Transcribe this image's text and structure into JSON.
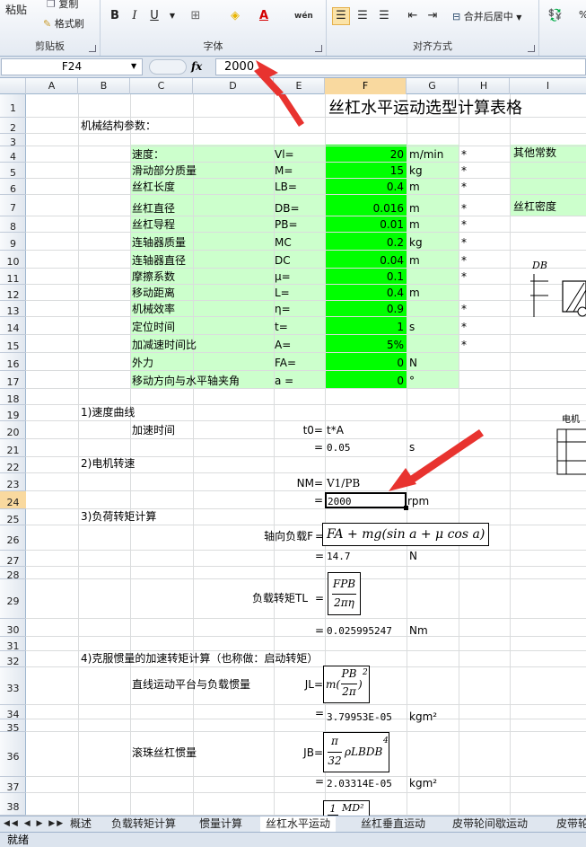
{
  "ribbon": {
    "clipboard": {
      "paste": "粘贴",
      "copy": "复制",
      "format_painter": "格式刷",
      "label": "剪贴板"
    },
    "font": {
      "label": "字体",
      "bold": "B",
      "italic": "I",
      "underline": "U",
      "wen": "wén"
    },
    "alignment": {
      "label": "对齐方式",
      "merge_center": "合并后居中"
    },
    "number": {
      "percent": "%"
    }
  },
  "formula_bar": {
    "name_box": "F24",
    "fx": "fx",
    "value": "2000"
  },
  "columns": [
    "A",
    "B",
    "C",
    "D",
    "E",
    "F",
    "G",
    "H",
    "I"
  ],
  "selected_column": "F",
  "rows": [
    "1",
    "2",
    "3",
    "4",
    "5",
    "6",
    "7",
    "8",
    "9",
    "10",
    "11",
    "12",
    "13",
    "14",
    "15",
    "16",
    "17",
    "18",
    "19",
    "20",
    "21",
    "22",
    "23",
    "24",
    "25",
    "26",
    "27",
    "28",
    "29",
    "30",
    "31",
    "32",
    "33",
    "34",
    "35",
    "36",
    "37",
    "38"
  ],
  "selected_row": "24",
  "sheet": {
    "title": "丝杠水平运动选型计算表格",
    "section_params": "机械结构参数：",
    "params": [
      {
        "name": "速度：",
        "sym": "Vl=",
        "val": "20",
        "unit": "m/min",
        "star": "*"
      },
      {
        "name": "滑动部分质量",
        "sym": "M=",
        "val": "15",
        "unit": "kg",
        "star": "*"
      },
      {
        "name": "丝杠长度",
        "sym": "LB=",
        "val": "0.4",
        "unit": "m",
        "star": "*"
      },
      {
        "name": "丝杠直径",
        "sym": "DB=",
        "val": "0.016",
        "unit": "m",
        "star": "*"
      },
      {
        "name": "丝杠导程",
        "sym": "PB=",
        "val": "0.01",
        "unit": "m",
        "star": "*"
      },
      {
        "name": "连轴器质量",
        "sym": "MC",
        "val": "0.2",
        "unit": "kg",
        "star": "*"
      },
      {
        "name": "连轴器直径",
        "sym": "DC",
        "val": "0.04",
        "unit": "m",
        "star": "*"
      },
      {
        "name": "摩擦系数",
        "sym": "μ=",
        "val": "0.1",
        "unit": "",
        "star": "*"
      },
      {
        "name": "移动距离",
        "sym": "L=",
        "val": "0.4",
        "unit": "m",
        "star": ""
      },
      {
        "name": "机械效率",
        "sym": "η=",
        "val": "0.9",
        "unit": "",
        "star": "*"
      },
      {
        "name": "定位时间",
        "sym": "t=",
        "val": "1",
        "unit": "s",
        "star": "*"
      },
      {
        "name": "加减速时间比",
        "sym": "A=",
        "val": "5%",
        "unit": "",
        "star": "*"
      },
      {
        "name": "外力",
        "sym": "FA=",
        "val": "0",
        "unit": "N",
        "star": ""
      },
      {
        "name": "移动方向与水平轴夹角",
        "sym": "a =",
        "val": "0",
        "unit": "°",
        "star": ""
      }
    ],
    "other_constants": "其他常数",
    "screw_density": "丝杠密度",
    "diagram_label_db": "DB",
    "diagram_label_motor": "电机",
    "s1": "1)速度曲线",
    "accel_time": "加速时间",
    "t0_label": "t0=",
    "t0_formula": "t*A",
    "eq": "=",
    "t0_value": "0.05",
    "t0_unit": "s",
    "s2": "2)电机转速",
    "nm_label": "NM=",
    "nm_formula": "V1/PB",
    "nm_value": "2000",
    "nm_unit": "rpm",
    "s3": "3)负荷转矩计算",
    "axial_load_label": "轴向负载F",
    "axial_formula": "FA + mg(sin a + μ cos a)",
    "axial_value": "14.7",
    "axial_unit": "N",
    "load_torque_label": "负载转矩TL",
    "tl_num": "FPB",
    "tl_den": "2πη",
    "tl_value": "0.025995247",
    "tl_unit": "Nm",
    "s4": "4)克服惯量的加速转矩计算（也称做：启动转矩）",
    "linear_inertia": "直线运动平台与负载惯量",
    "jl_label": "JL=",
    "jl_formula_pre": "m(",
    "jl_num": "PB",
    "jl_den": "2π",
    "jl_post": ")",
    "jl_exp": "2",
    "jl_value": "3.79953E-05",
    "jl_unit": "kgm²",
    "screw_inertia": "滚珠丝杠惯量",
    "jb_label": "JB=",
    "jb_num": "π",
    "jb_den": "32",
    "jb_rest": "ρLBDB",
    "jb_exp": "4",
    "jb_value": "2.03314E-05",
    "jb_unit": "kgm²",
    "row38_num": "1",
    "row38_den": "MD²"
  },
  "sheet_tabs": [
    "概述",
    "负载转矩计算",
    "惯量计算",
    "丝杠水平运动",
    "丝杠垂直运动",
    "皮带轮间歇运动",
    "皮带轮"
  ],
  "active_tab": "丝杠水平运动",
  "status": "就绪",
  "colors": {
    "light_green": "#ccffcc",
    "bright_green": "#00ff00",
    "arrow_red": "#e8332f",
    "select_orange": "#f9d99f"
  }
}
